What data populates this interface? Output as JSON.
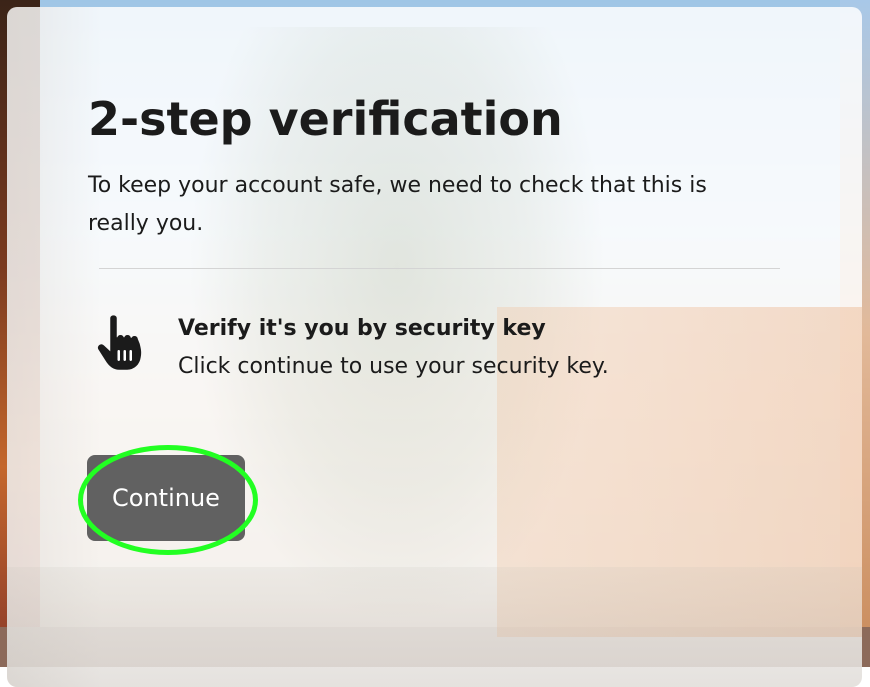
{
  "page": {
    "title": "2-step verification",
    "subtitle": "To keep your account safe, we need to check that this is really you."
  },
  "method": {
    "icon": "pointing-hand-icon",
    "title": "Verify it's you by security key",
    "description": "Click continue to use your security key."
  },
  "actions": {
    "continue_label": "Continue"
  },
  "colors": {
    "button_bg": "#616161",
    "highlight": "#22ff22",
    "text": "#1b1b1b"
  }
}
